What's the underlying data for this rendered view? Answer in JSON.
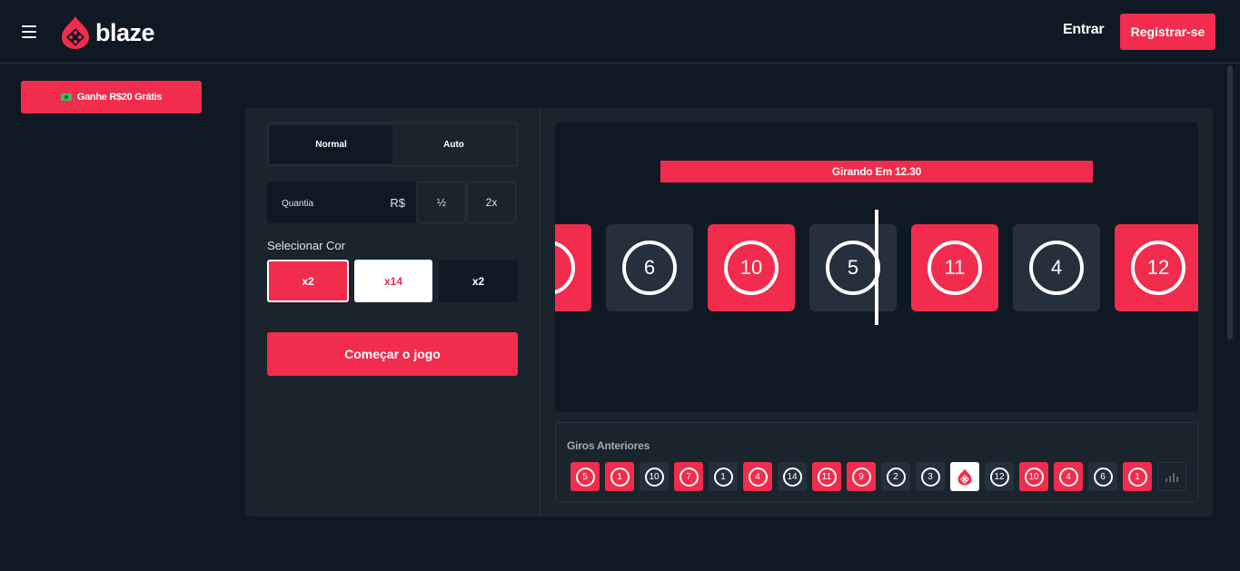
{
  "header": {
    "logo_text": "blaze",
    "login_label": "Entrar",
    "register_label": "Registrar-se"
  },
  "promo": {
    "label": "Ganhe R$20 Grátis"
  },
  "controls": {
    "tabs": [
      "Normal",
      "Auto"
    ],
    "active_tab": "Normal",
    "amount_label": "Quantia",
    "currency": "R$",
    "half_label": "½",
    "double_label": "2x",
    "select_color_title": "Selecionar Cor",
    "colors": [
      {
        "label": "x2",
        "color": "red"
      },
      {
        "label": "x14",
        "color": "white"
      },
      {
        "label": "x2",
        "color": "black"
      }
    ],
    "start_label": "Começar o jogo"
  },
  "wheel": {
    "timer_text": "Girando Em 12.30",
    "tiles": [
      {
        "number": "",
        "color": "red"
      },
      {
        "number": "6",
        "color": "black"
      },
      {
        "number": "10",
        "color": "red"
      },
      {
        "number": "5",
        "color": "black"
      },
      {
        "number": "11",
        "color": "red"
      },
      {
        "number": "4",
        "color": "black"
      },
      {
        "number": "12",
        "color": "red"
      }
    ]
  },
  "history": {
    "title": "Giros Anteriores",
    "items": [
      {
        "number": "5",
        "color": "red"
      },
      {
        "number": "1",
        "color": "red"
      },
      {
        "number": "10",
        "color": "black"
      },
      {
        "number": "7",
        "color": "red"
      },
      {
        "number": "1",
        "color": "black"
      },
      {
        "number": "4",
        "color": "red"
      },
      {
        "number": "14",
        "color": "black"
      },
      {
        "number": "11",
        "color": "red"
      },
      {
        "number": "9",
        "color": "red"
      },
      {
        "number": "2",
        "color": "black"
      },
      {
        "number": "3",
        "color": "black"
      },
      {
        "number": "",
        "color": "white"
      },
      {
        "number": "12",
        "color": "black"
      },
      {
        "number": "10",
        "color": "red"
      },
      {
        "number": "4",
        "color": "red"
      },
      {
        "number": "6",
        "color": "black"
      },
      {
        "number": "1",
        "color": "red"
      }
    ]
  },
  "colors": {
    "accent": "#f12c4c",
    "background": "#0f1923",
    "panel": "#1a242d",
    "tile_dark": "#262f3c"
  }
}
